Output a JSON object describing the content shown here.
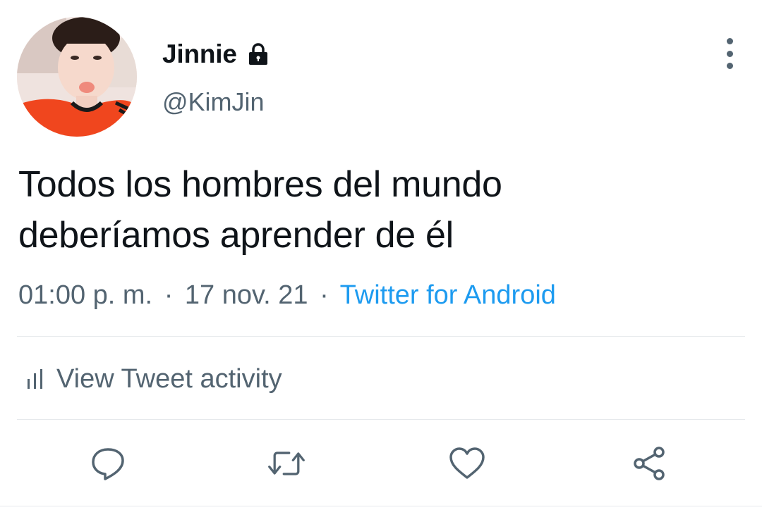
{
  "user": {
    "display_name": "Jinnie",
    "handle": "@KimJin",
    "protected_icon": "lock-icon",
    "avatar_icon": "profile-photo"
  },
  "tweet": {
    "text_line1": "Todos los hombres del mundo",
    "text_line2": "deberíamos aprender de él",
    "time": "01:00 p. m.",
    "separator": "·",
    "date": "17 nov. 21",
    "source": "Twitter for Android"
  },
  "activity": {
    "label": "View Tweet activity",
    "icon": "bar-chart-icon"
  },
  "actions": {
    "reply_icon": "reply-icon",
    "retweet_icon": "retweet-icon",
    "like_icon": "heart-icon",
    "share_icon": "share-icon",
    "more_icon": "more-vertical-icon"
  },
  "colors": {
    "text": "#0f1419",
    "secondary": "#536471",
    "link": "#1d9bf0",
    "divider": "#e6e9ec",
    "avatar_shirt": "#f0461e"
  }
}
